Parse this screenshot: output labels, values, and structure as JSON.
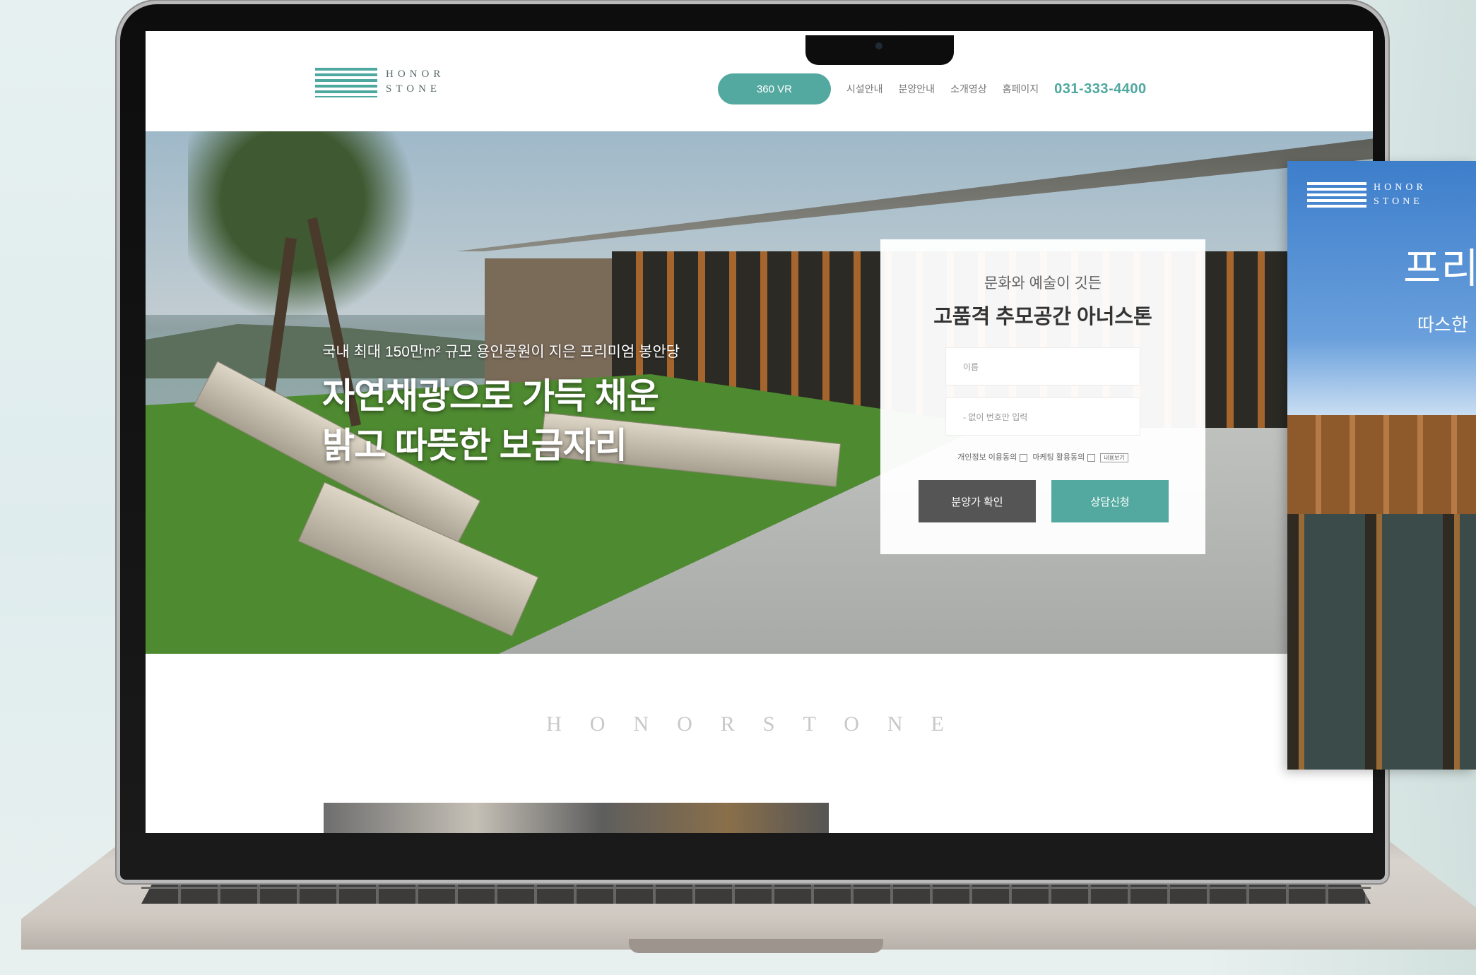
{
  "header": {
    "logo_line1": "HONOR",
    "logo_line2": "STONE",
    "vr_button": "360 VR",
    "nav_items": [
      "시설안내",
      "분양안내",
      "소개영상",
      "홈페이지"
    ],
    "phone": "031-333-4400"
  },
  "hero": {
    "subtitle": "국내 최대 150만m² 규모 용인공원이 지은 프리미엄 봉안당",
    "title_line1": "자연채광으로 가득 채운",
    "title_line2": "밝고 따뜻한 보금자리"
  },
  "form": {
    "subtitle": "문화와 예술이 깃든",
    "title": "고품격 추모공간 아너스톤",
    "name_placeholder": "이름",
    "phone_placeholder": "- 없이 번호만 입력",
    "agree_privacy": "개인정보 이용동의",
    "agree_marketing": "마케팅 활용동의",
    "view_label": "내용보기",
    "btn_price": "분양가 확인",
    "btn_consult": "상담신청"
  },
  "section": {
    "brand_spaced": "HONORSTONE"
  },
  "side_card": {
    "logo_line1": "HONOR",
    "logo_line2": "STONE",
    "title": "프리",
    "subtitle": "따스한"
  },
  "colors": {
    "accent": "#53a9a0",
    "dark_button": "#555555",
    "side_card_blue": "#3d7ecb"
  }
}
